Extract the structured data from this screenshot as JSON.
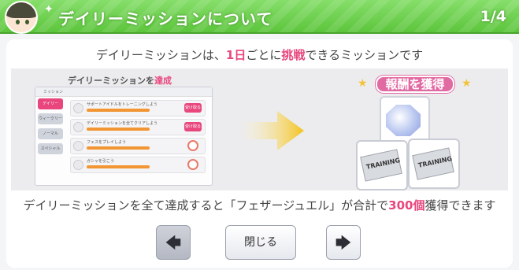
{
  "header": {
    "title": "デイリーミッションについて",
    "page_indicator": "1/4"
  },
  "description_top": {
    "prefix": "デイリーミッションは、",
    "highlight1": "1日",
    "middle": "ごとに",
    "highlight2": "挑戦",
    "suffix": "できるミッションです"
  },
  "illustration": {
    "mini_heading_prefix": "デイリーミッションを",
    "mini_heading_highlight": "達成",
    "mini_title": "ミッション",
    "mini_tabs": [
      "デイリー",
      "ウィークリー",
      "ノーマル",
      "スペシャル"
    ],
    "mini_rows": [
      {
        "text": "サポートアイドルをトレーニングしよう",
        "action": "受け取る"
      },
      {
        "text": "デイリーミッションを全てクリアしよう",
        "action": "受け取る"
      },
      {
        "text": "フェスをプレイしよう",
        "action": ""
      },
      {
        "text": "ガシャを引こう",
        "action": ""
      }
    ],
    "reward_label": "報酬を獲得",
    "ticket_label": "TRAINING"
  },
  "description_bottom": {
    "prefix": "デイリーミッションを全て達成すると「フェザージュエル」が合計で",
    "highlight": "300個",
    "suffix": "獲得できます"
  },
  "buttons": {
    "close_label": "閉じる",
    "prev_icon": "arrow-left-icon",
    "next_icon": "arrow-right-icon"
  },
  "colors": {
    "header_green": "#5cc53c",
    "accent_pink": "#e8467c"
  }
}
